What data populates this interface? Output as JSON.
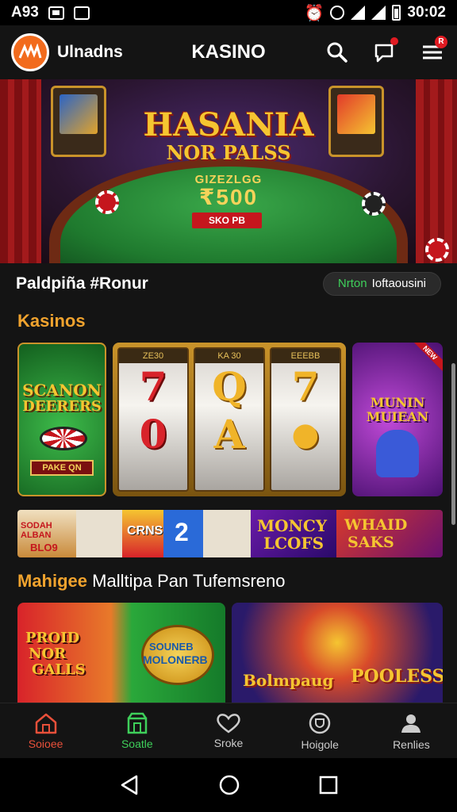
{
  "status_bar": {
    "left_text": "A93",
    "time": "30:02"
  },
  "header": {
    "brand": "Ulnadns",
    "title": "KASINO",
    "notif_count": "R"
  },
  "hero": {
    "title": "HASANIA",
    "subtitle": "NOR PALSS",
    "prefix": "GIZEZLGG",
    "amount": "₹500",
    "tag": "SKO PB"
  },
  "promo": {
    "title": "Paldpiña #Ronur",
    "pill_green": "Nrton",
    "pill_text": "Ioftaousini"
  },
  "kasino": {
    "title": "Kasinos",
    "cards": [
      {
        "title": "SCANON",
        "sub": "DEERERS",
        "bottom": "PAKE QN"
      },
      {
        "reel_labels": [
          "ZE30",
          "KA 30",
          "EEEBB"
        ],
        "reel1": [
          "7",
          "0"
        ],
        "reel2": [
          "Q",
          "A"
        ],
        "reel3": [
          "7",
          "●"
        ]
      },
      {
        "title": "MUNIN",
        "sub": "MUIEAN",
        "badge": "NEW"
      }
    ]
  },
  "strip": [
    {
      "text": "SODAH",
      "sub": "ALBAN",
      "num": "BLO9"
    },
    {
      "text": "CRNS"
    },
    {
      "text": "2"
    },
    {
      "text": "MONCY",
      "sub": "LCOFS"
    },
    {
      "text": "WHAID",
      "sub": "SAKS"
    }
  ],
  "multiplayer": {
    "title_prefix": "Mahigee",
    "title_rest": "Malltipa Pan Tufemsreno",
    "cards": [
      {
        "title": "PROID",
        "sub": "NOR",
        "sub2": "GALLS",
        "right": "MOLONERB",
        "right2": "SOUNEB"
      },
      {
        "title": "Bolmpaug",
        "right": "POOLESS"
      }
    ]
  },
  "bottom_nav": [
    {
      "label": "Soioee",
      "icon": "home-icon"
    },
    {
      "label": "Soatle",
      "icon": "store-icon"
    },
    {
      "label": "Sroke",
      "icon": "heart-icon"
    },
    {
      "label": "Hoigole",
      "icon": "trophy-icon"
    },
    {
      "label": "Renlies",
      "icon": "profile-icon"
    }
  ],
  "colors": {
    "accent_orange": "#f0a32e",
    "accent_green": "#3ecf5a",
    "brand_orange": "#f26b1d",
    "bg": "#141414"
  }
}
